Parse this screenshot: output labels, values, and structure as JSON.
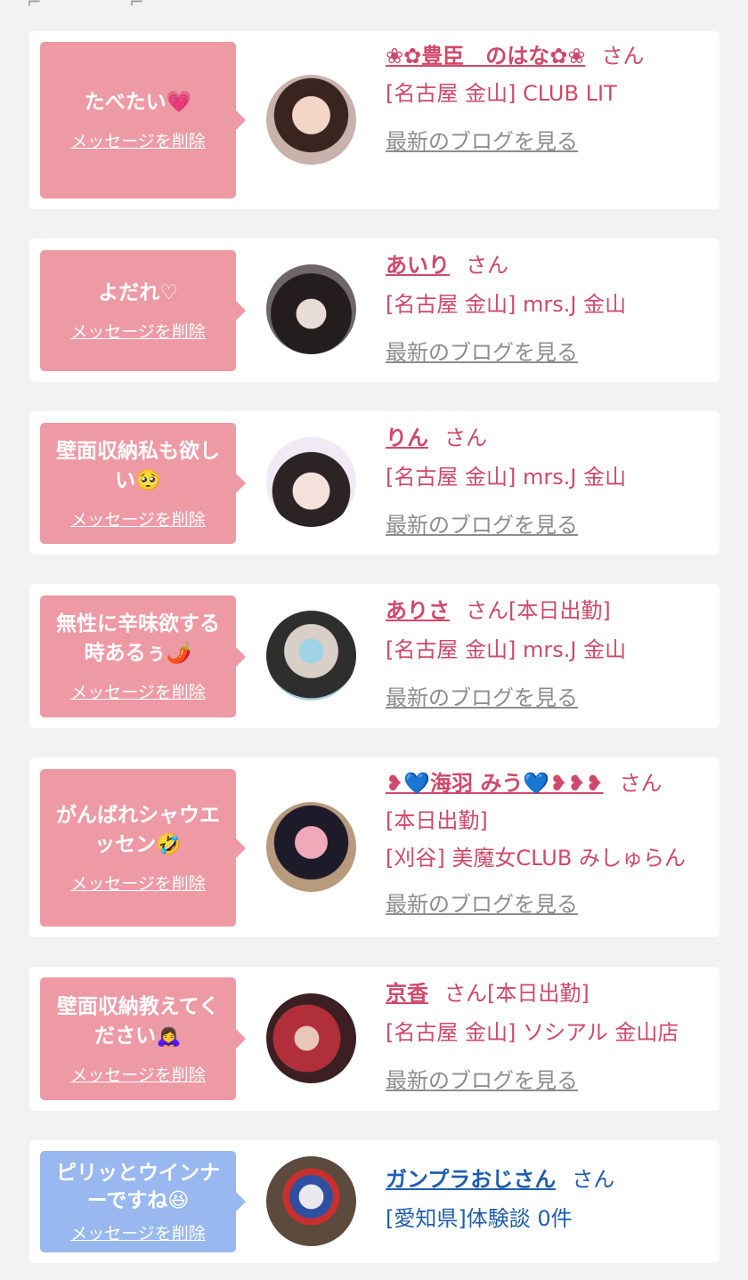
{
  "messages": [
    {
      "bubble_text": "たべたい💗",
      "delete_label": "メッセージを削除",
      "name": "❀✿豊臣　のはな✿❀",
      "honorific": "さん",
      "suffix": "",
      "location": "[名古屋 金山] CLUB LIT",
      "blog_label": "最新のブログを見る",
      "theme": "pink"
    },
    {
      "bubble_text": "よだれ♡",
      "delete_label": "メッセージを削除",
      "name": "あいり",
      "honorific": "さん",
      "suffix": "",
      "location": "[名古屋 金山] mrs.J 金山",
      "blog_label": "最新のブログを見る",
      "theme": "pink"
    },
    {
      "bubble_text": "壁面収納私も欲しい🥺",
      "delete_label": "メッセージを削除",
      "name": "りん",
      "honorific": "さん",
      "suffix": "",
      "location": "[名古屋 金山] mrs.J 金山",
      "blog_label": "最新のブログを見る",
      "theme": "pink"
    },
    {
      "bubble_text": "無性に辛味欲する時あるぅ🌶️",
      "delete_label": "メッセージを削除",
      "name": "ありさ",
      "honorific": "さん",
      "suffix": "[本日出勤]",
      "location": "[名古屋 金山] mrs.J 金山",
      "blog_label": "最新のブログを見る",
      "theme": "pink"
    },
    {
      "bubble_text": "がんばれシャウエッセン🤣",
      "delete_label": "メッセージを削除",
      "name": "❥💙海羽 みう💙❥❥❥",
      "honorific": "さん",
      "suffix": "[本日出勤]",
      "location": "[刈谷] 美魔女CLUB みしゅらん",
      "blog_label": "最新のブログを見る",
      "theme": "pink"
    },
    {
      "bubble_text": "壁面収納教えてください🙇‍♀️",
      "delete_label": "メッセージを削除",
      "name": "京香",
      "honorific": "さん",
      "suffix": "[本日出勤]",
      "location": "[名古屋 金山] ソシアル 金山店",
      "blog_label": "最新のブログを見る",
      "theme": "pink"
    },
    {
      "bubble_text": "ピリッとウインナーですね😆",
      "delete_label": "メッセージを削除",
      "name": "ガンプラおじさん",
      "honorific": "さん",
      "suffix": "",
      "location": "[愛知県]体験談 0件",
      "blog_label": "",
      "theme": "blue"
    }
  ],
  "colors": {
    "pink_bubble": "#ee9aa5",
    "blue_bubble": "#98b8ef",
    "pink_text": "#d0496a",
    "blue_text": "#1f5db0",
    "blog_link": "#8d8d8d",
    "background": "#f2f2f2"
  }
}
